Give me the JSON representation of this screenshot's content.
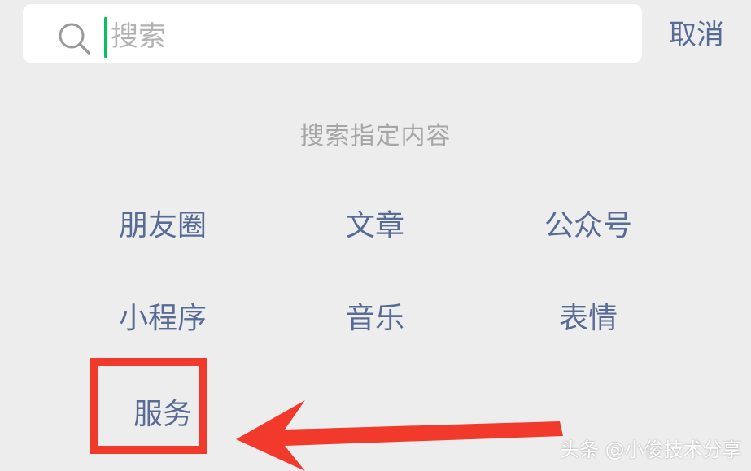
{
  "search": {
    "placeholder": "搜索",
    "cancel_label": "取消"
  },
  "section_title": "搜索指定内容",
  "categories": [
    {
      "label": "朋友圈"
    },
    {
      "label": "文章"
    },
    {
      "label": "公众号"
    },
    {
      "label": "小程序"
    },
    {
      "label": "音乐"
    },
    {
      "label": "表情"
    },
    {
      "label": "服务"
    }
  ],
  "watermark": "头条 @小俊技术分享",
  "colors": {
    "background": "#ededed",
    "link_blue": "#576b95",
    "caret_green": "#07c160",
    "placeholder_gray": "#b2b2b2",
    "annotation_red": "#f23a2c"
  },
  "icons": {
    "search": "search-icon",
    "arrow": "arrow-left-icon"
  }
}
